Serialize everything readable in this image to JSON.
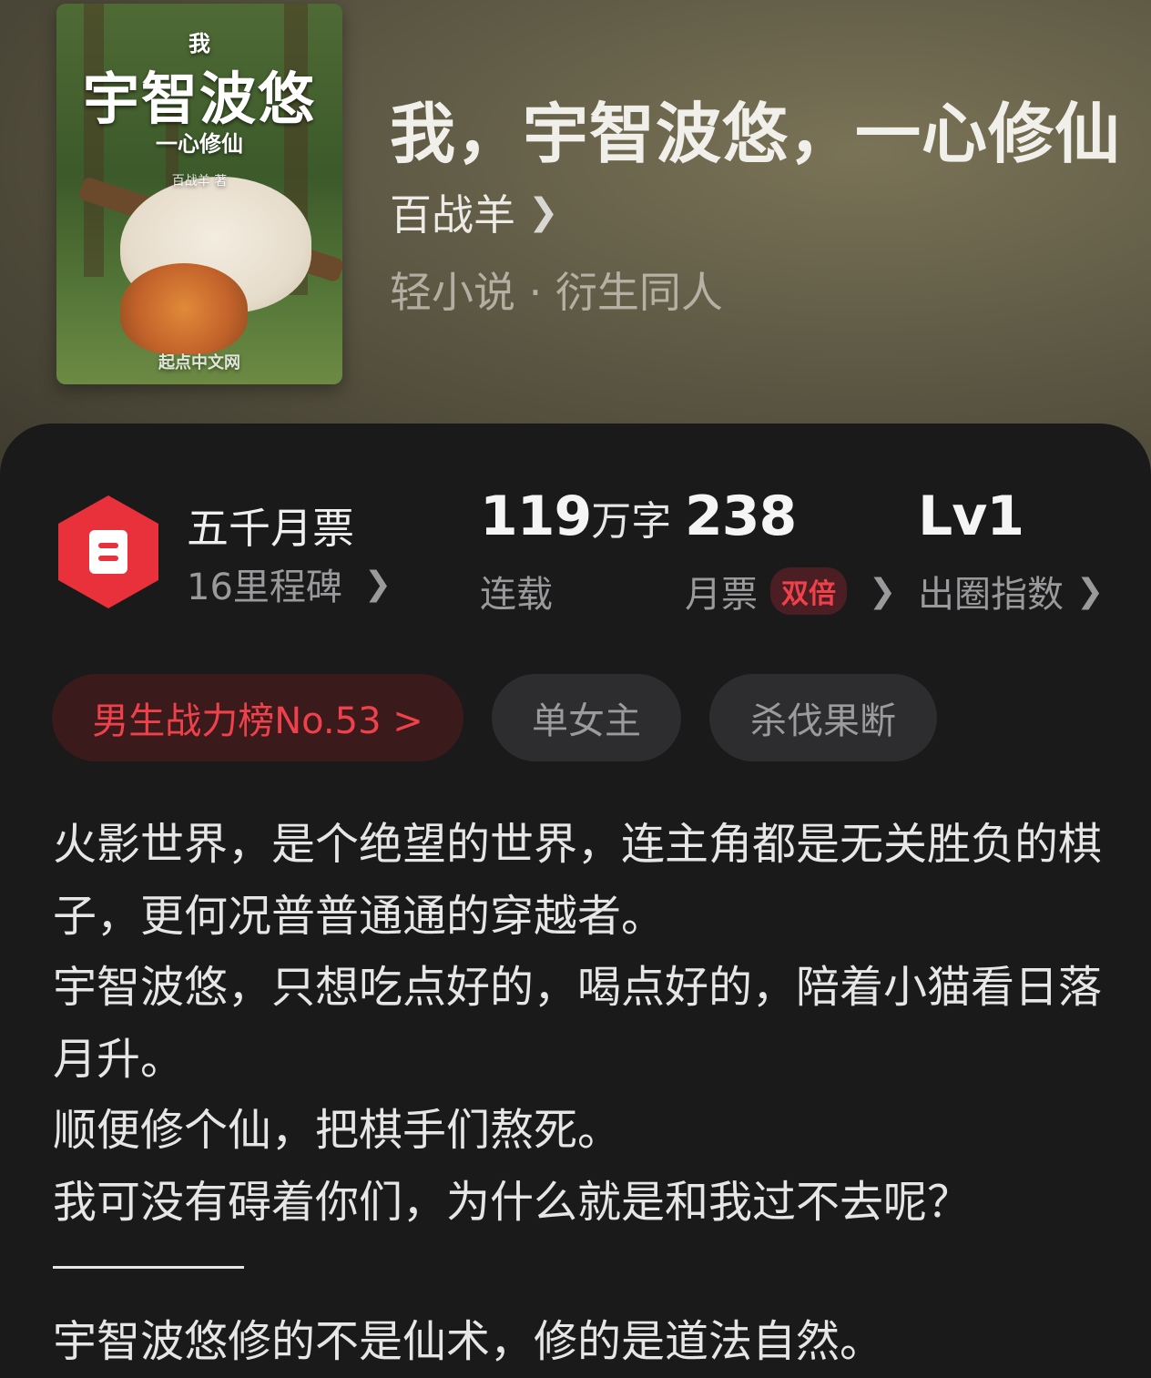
{
  "cover": {
    "top_text": "我",
    "title_text": "宇智波悠",
    "subtitle_text": "一心修仙",
    "author_text": "百战羊 著",
    "brand_text": "起点中文网"
  },
  "book": {
    "title": "我，宇智波悠，一心修仙",
    "author": "百战羊",
    "genres": "轻小说 · 衍生同人"
  },
  "stats": {
    "milestone_title": "五千月票",
    "milestone_sub": "16里程碑",
    "words_num": "119",
    "words_unit": "万字",
    "words_status": "连载",
    "tickets_num": "238",
    "tickets_label": "月票",
    "tickets_badge": "双倍",
    "level": "Lv1",
    "level_label": "出圈指数"
  },
  "tags": {
    "rank": "男生战力榜No.53 >",
    "tag1": "单女主",
    "tag2": "杀伐果断"
  },
  "description": {
    "p1": "火影世界，是个绝望的世界，连主角都是无关胜负的棋子，更何况普普通通的穿越者。",
    "p2": "宇智波悠，只想吃点好的，喝点好的，陪着小猫看日落月升。",
    "p3": "顺便修个仙，把棋手们熬死。",
    "p4": "我可没有碍着你们，为什么就是和我过不去呢？",
    "p5": "宇智波悠修的不是仙术，修的是道法自然。"
  },
  "colors": {
    "accent_red": "#e8313b",
    "rank_bg": "#3b1a1c",
    "tag_bg": "#2d2d2f",
    "panel_bg": "#1a1a1b",
    "header_bg": "#5f5a45"
  }
}
